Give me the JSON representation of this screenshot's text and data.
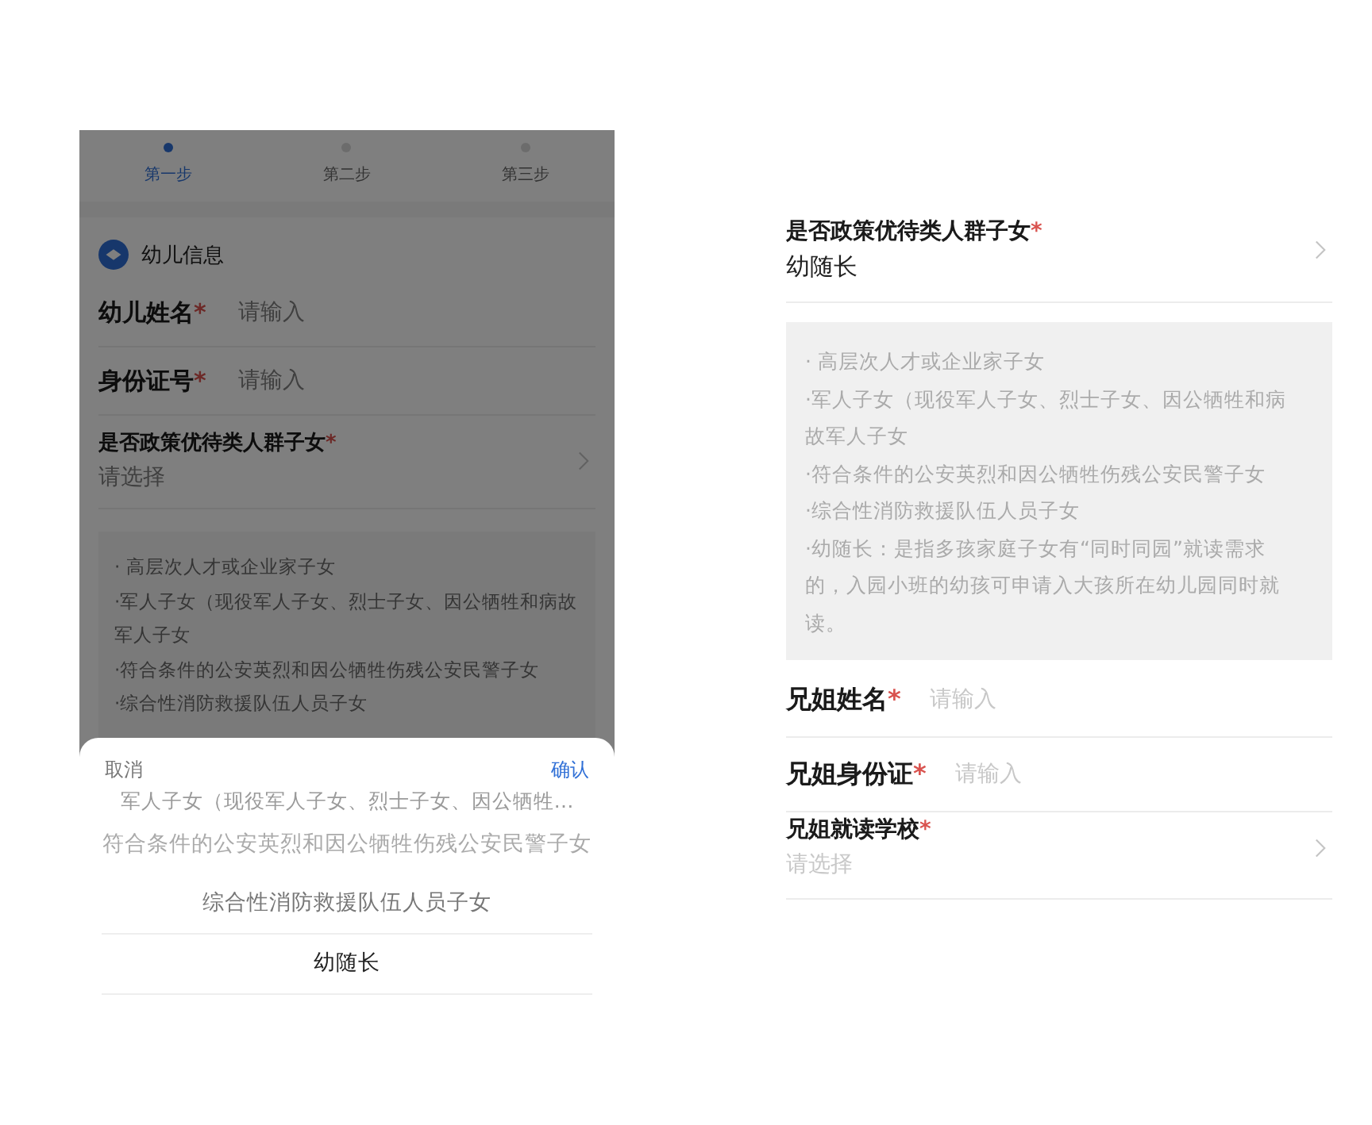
{
  "left_screen": {
    "steps": [
      {
        "label": "第一步",
        "selected": true
      },
      {
        "label": "第二步",
        "selected": false
      },
      {
        "label": "第三步",
        "selected": false
      }
    ],
    "section_title": "幼儿信息",
    "items": [
      {
        "kind": "input",
        "label": "幼儿姓名",
        "mark": "*",
        "placeholder": "请输入"
      },
      {
        "kind": "input",
        "label": "身份证号",
        "mark": "*",
        "placeholder": "请输入"
      },
      {
        "kind": "select",
        "label": "是否政策优待类人群子女",
        "mark": "*",
        "placeholder": "请选择"
      },
      {
        "kind": "notes",
        "lines": [
          "· 高层次人才或企业家子女",
          "·军人子女（现役军人子女、烈士子女、因公牺牲和病故军人子女",
          "·符合条件的公安英烈和因公牺牲伤残公安民警子女",
          "·综合性消防救援队伍人员子女"
        ]
      }
    ],
    "picker": {
      "cancel": "取消",
      "confirm": "确认",
      "options": [
        {
          "label": "军人子女（现役军人子女、烈士子女、因公牺牲…",
          "selected": false
        },
        {
          "label": "符合条件的公安英烈和因公牺牲伤残公安民警子女",
          "selected": false
        },
        {
          "label": "综合性消防救援队伍人员子女",
          "selected": false
        },
        {
          "label": "幼随长",
          "selected": true
        }
      ]
    }
  },
  "right_screen": {
    "items": [
      {
        "kind": "select",
        "label": "是否政策优待类人群子女",
        "mark": "*",
        "value": "幼随长"
      },
      {
        "kind": "notes",
        "lines": [
          "· 高层次人才或企业家子女",
          "·军人子女（现役军人子女、烈士子女、因公牺牲和病故军人子女",
          "·符合条件的公安英烈和因公牺牲伤残公安民警子女",
          "·综合性消防救援队伍人员子女",
          "·幼随长：是指多孩家庭子女有“同时同园”就读需求的，入园小班的幼孩可申请入大孩所在幼儿园同时就读。"
        ]
      },
      {
        "kind": "input",
        "label": "兄姐姓名",
        "mark": "*",
        "placeholder": "请输入"
      },
      {
        "kind": "input",
        "label": "兄姐身份证",
        "mark": "*",
        "placeholder": "请输入"
      },
      {
        "kind": "select",
        "label": "兄姐就读学校",
        "mark": "*",
        "placeholder": "请选择"
      }
    ]
  }
}
